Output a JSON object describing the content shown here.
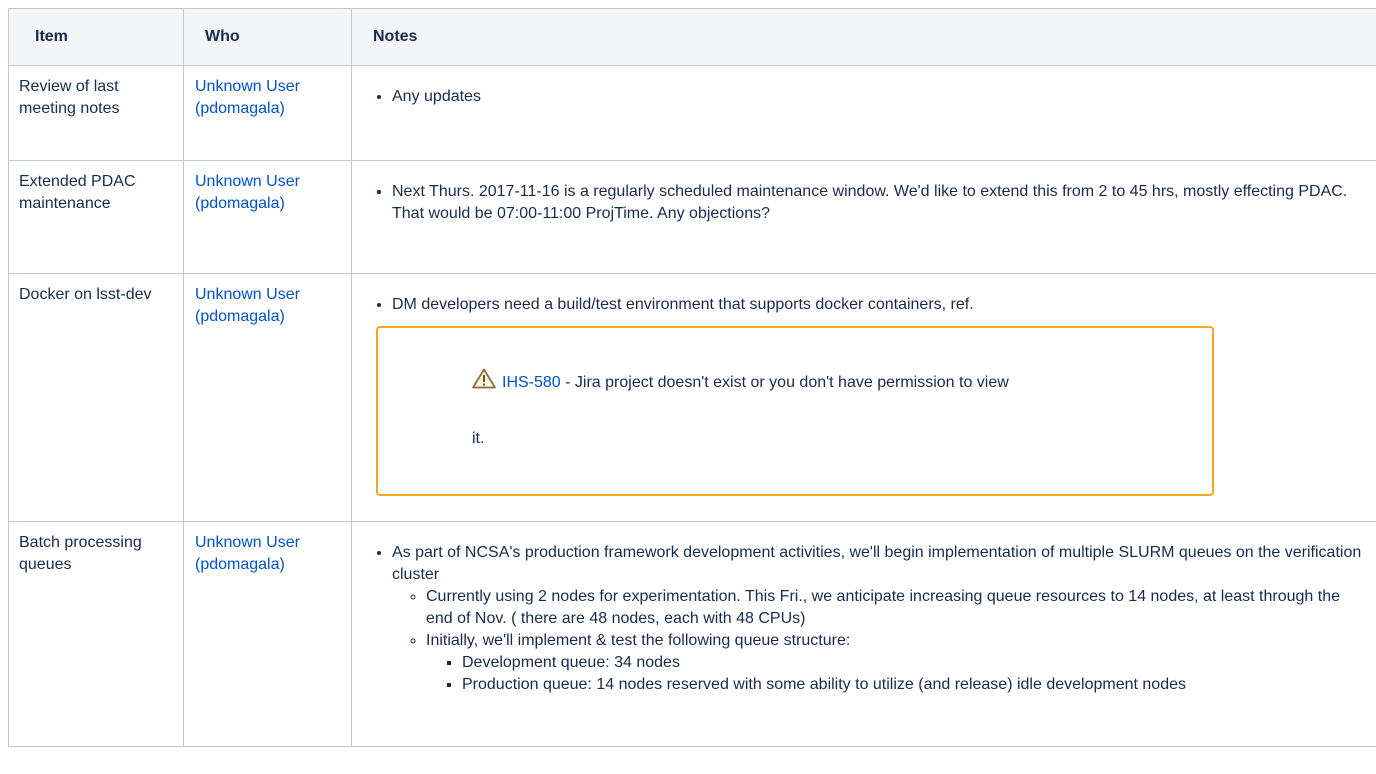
{
  "table": {
    "headers": {
      "item": "Item",
      "who": "Who",
      "notes": "Notes"
    },
    "rows": [
      {
        "item": "Review of last meeting notes",
        "who_line1": "Unknown User",
        "who_line2": "(pdomagala)",
        "notes": [
          "Any updates"
        ]
      },
      {
        "item": "Extended PDAC maintenance",
        "who_line1": "Unknown User",
        "who_line2": "(pdomagala)",
        "notes": [
          "Next Thurs. 2017-11-16 is a regularly scheduled maintenance window. We'd like to extend this from 2 to 45 hrs, mostly effecting PDAC. That would be 07:00-11:00 ProjTime. Any objections?"
        ]
      },
      {
        "item": "Docker on lsst-dev",
        "who_line1": "Unknown User",
        "who_line2": "(pdomagala)",
        "notes": [
          "DM developers need a build/test environment that supports docker containers, ref."
        ],
        "jira": {
          "icon": "warning-triangle-icon",
          "key": "IHS-580",
          "message": " - Jira project doesn't exist or you don't have permission to view",
          "message_tail": "it.",
          "border_color": "#f5a623"
        }
      },
      {
        "item": "Batch processing queues",
        "who_line1": "Unknown User",
        "who_line2": "(pdomagala)",
        "notes_main": "As part of NCSA's production framework development activities, we'll begin implementation of multiple SLURM queues on the verification cluster",
        "notes_sub": [
          "Currently using 2 nodes for experimentation. This Fri., we anticipate increasing queue resources to 14 nodes, at least through the end of Nov. ( there are 48 nodes, each with 48 CPUs)",
          "Initially, we'll implement & test the following queue structure:"
        ],
        "notes_subsub": [
          "Development queue: 34 nodes",
          "Production queue: 14 nodes reserved with some ability to utilize (and release) idle development nodes"
        ]
      }
    ]
  },
  "colors": {
    "link": "#0052cc",
    "header_bg": "#f4f5f7",
    "border": "#c1c7d0",
    "text": "#172b4d"
  }
}
